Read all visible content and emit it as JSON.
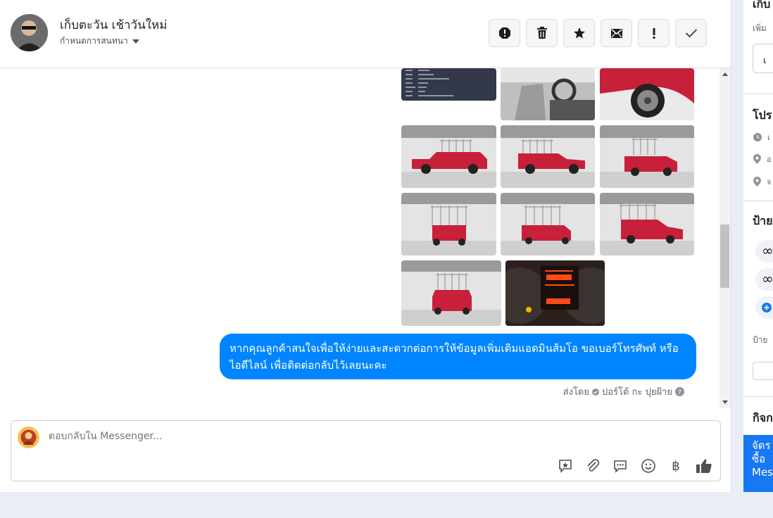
{
  "header": {
    "contact_name": "เก็บตะวัน เช้าวันใหม่",
    "assign_label": "กำหนดการสนทนา",
    "actions": [
      "spam-icon",
      "trash-icon",
      "star-icon",
      "unread-icon",
      "important-icon",
      "check-icon"
    ]
  },
  "thread": {
    "message": "หากคุณลูกค้าสนใจเพื่อให้ง่ายและสะดวกต่อการให้ข้อมูลเพิ่มเติมแอดมินส้มโอ ขอเบอร์โทรศัพท์ หรือ ไอดีไลน์ เพื่อติดต่อกลับไว้เลยนะคะ",
    "sent_by_prefix": "ส่งโดย",
    "sent_by_name": "ปอร์โต้ กะ ปุยฝ้าย"
  },
  "composer": {
    "placeholder": "ตอบกลับใน Messenger...",
    "currency_symbol": "฿"
  },
  "sidebar": {
    "title_top": "เก็บ",
    "sub_top": "เพิ่ม",
    "btn_top": "เ",
    "profile_title": "โปร",
    "profile_items": [
      "เ",
      "อ",
      "จ"
    ],
    "labels_title": "ป้าย",
    "label_glyph": "∞",
    "labels_sub": "ป้าย",
    "activity_title": "กิจก",
    "cta_text": [
      "จัดร",
      "ซื้อ",
      "Mes"
    ]
  },
  "colors": {
    "accent": "#0084ff",
    "cta": "#1877f2",
    "car_red": "#c8203a"
  }
}
